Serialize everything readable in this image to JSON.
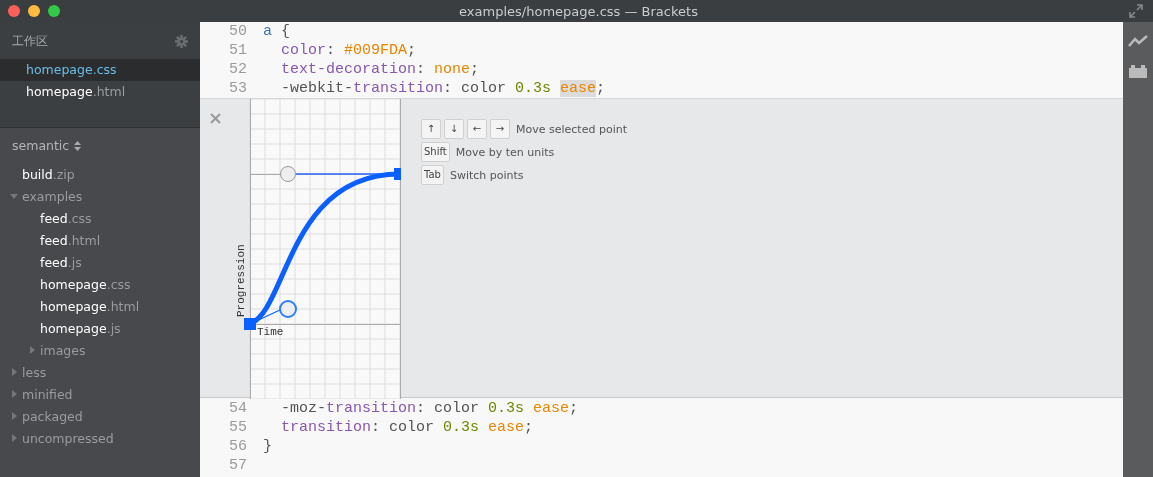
{
  "window": {
    "title": "examples/homepage.css — Brackets"
  },
  "sidebar": {
    "working_set": {
      "title": "工作区",
      "items": [
        {
          "name": "homepage",
          "ext": ".css",
          "selected": true
        },
        {
          "name": "homepage",
          "ext": ".html",
          "selected": false
        }
      ]
    },
    "project": {
      "title": "semantic",
      "tree": [
        {
          "name": "build",
          "ext": ".zip",
          "kind": "file"
        },
        {
          "name": "examples",
          "kind": "folder",
          "expanded": true,
          "children": [
            {
              "name": "feed",
              "ext": ".css",
              "kind": "file"
            },
            {
              "name": "feed",
              "ext": ".html",
              "kind": "file"
            },
            {
              "name": "feed",
              "ext": ".js",
              "kind": "file"
            },
            {
              "name": "homepage",
              "ext": ".css",
              "kind": "file"
            },
            {
              "name": "homepage",
              "ext": ".html",
              "kind": "file"
            },
            {
              "name": "homepage",
              "ext": ".js",
              "kind": "file"
            },
            {
              "name": "images",
              "kind": "folder",
              "expanded": false
            }
          ]
        },
        {
          "name": "less",
          "kind": "folder",
          "expanded": false
        },
        {
          "name": "minified",
          "kind": "folder",
          "expanded": false
        },
        {
          "name": "packaged",
          "kind": "folder",
          "expanded": false
        },
        {
          "name": "uncompressed",
          "kind": "folder",
          "expanded": false
        }
      ]
    }
  },
  "editor": {
    "lines_before": [
      {
        "number": "50",
        "tokens": [
          {
            "text": "a",
            "kind": "tag",
            "highlighted": false
          },
          {
            "text": " {",
            "kind": "plain",
            "highlighted": false
          }
        ]
      },
      {
        "number": "51",
        "tokens": [
          {
            "text": "  color",
            "kind": "property",
            "highlighted": false
          },
          {
            "text": ": ",
            "kind": "plain",
            "highlighted": false
          },
          {
            "text": "#009FDA",
            "kind": "value",
            "highlighted": false
          },
          {
            "text": ";",
            "kind": "plain",
            "highlighted": false
          }
        ]
      },
      {
        "number": "52",
        "tokens": [
          {
            "text": "  text-decoration",
            "kind": "property",
            "highlighted": false
          },
          {
            "text": ": ",
            "kind": "plain",
            "highlighted": false
          },
          {
            "text": "none",
            "kind": "value",
            "highlighted": false
          },
          {
            "text": ";",
            "kind": "plain",
            "highlighted": false
          }
        ]
      },
      {
        "number": "53",
        "tokens": [
          {
            "text": "  -webkit-",
            "kind": "plain",
            "highlighted": false
          },
          {
            "text": "transition",
            "kind": "property",
            "highlighted": false
          },
          {
            "text": ": color ",
            "kind": "plain",
            "highlighted": false
          },
          {
            "text": "0.3s ",
            "kind": "number",
            "highlighted": false
          },
          {
            "text": "ease",
            "kind": "value",
            "highlighted": true
          },
          {
            "text": ";",
            "kind": "plain",
            "highlighted": false
          }
        ]
      }
    ],
    "bezier_editor": {
      "y_label": "Progression",
      "x_label": "Time",
      "hints": [
        {
          "keys": [
            "↑",
            "↓",
            "←",
            "→"
          ],
          "text": "Move selected point"
        },
        {
          "keys": [
            "Shift"
          ],
          "text": "Move by ten units"
        },
        {
          "keys": [
            "Tab"
          ],
          "text": "Switch points"
        }
      ]
    },
    "lines_after": [
      {
        "number": "54",
        "tokens": [
          {
            "text": "  -moz-",
            "kind": "plain",
            "highlighted": false
          },
          {
            "text": "transition",
            "kind": "property",
            "highlighted": false
          },
          {
            "text": ": color ",
            "kind": "plain",
            "highlighted": false
          },
          {
            "text": "0.3s ",
            "kind": "number",
            "highlighted": false
          },
          {
            "text": "ease",
            "kind": "value",
            "highlighted": false
          },
          {
            "text": ";",
            "kind": "plain",
            "highlighted": false
          }
        ]
      },
      {
        "number": "55",
        "tokens": [
          {
            "text": "  transition",
            "kind": "property",
            "highlighted": false
          },
          {
            "text": ": color ",
            "kind": "plain",
            "highlighted": false
          },
          {
            "text": "0.3s ",
            "kind": "number",
            "highlighted": false
          },
          {
            "text": "ease",
            "kind": "value",
            "highlighted": false
          },
          {
            "text": ";",
            "kind": "plain",
            "highlighted": false
          }
        ]
      },
      {
        "number": "56",
        "tokens": [
          {
            "text": "}",
            "kind": "plain",
            "highlighted": false
          }
        ]
      },
      {
        "number": "57"
      }
    ]
  }
}
